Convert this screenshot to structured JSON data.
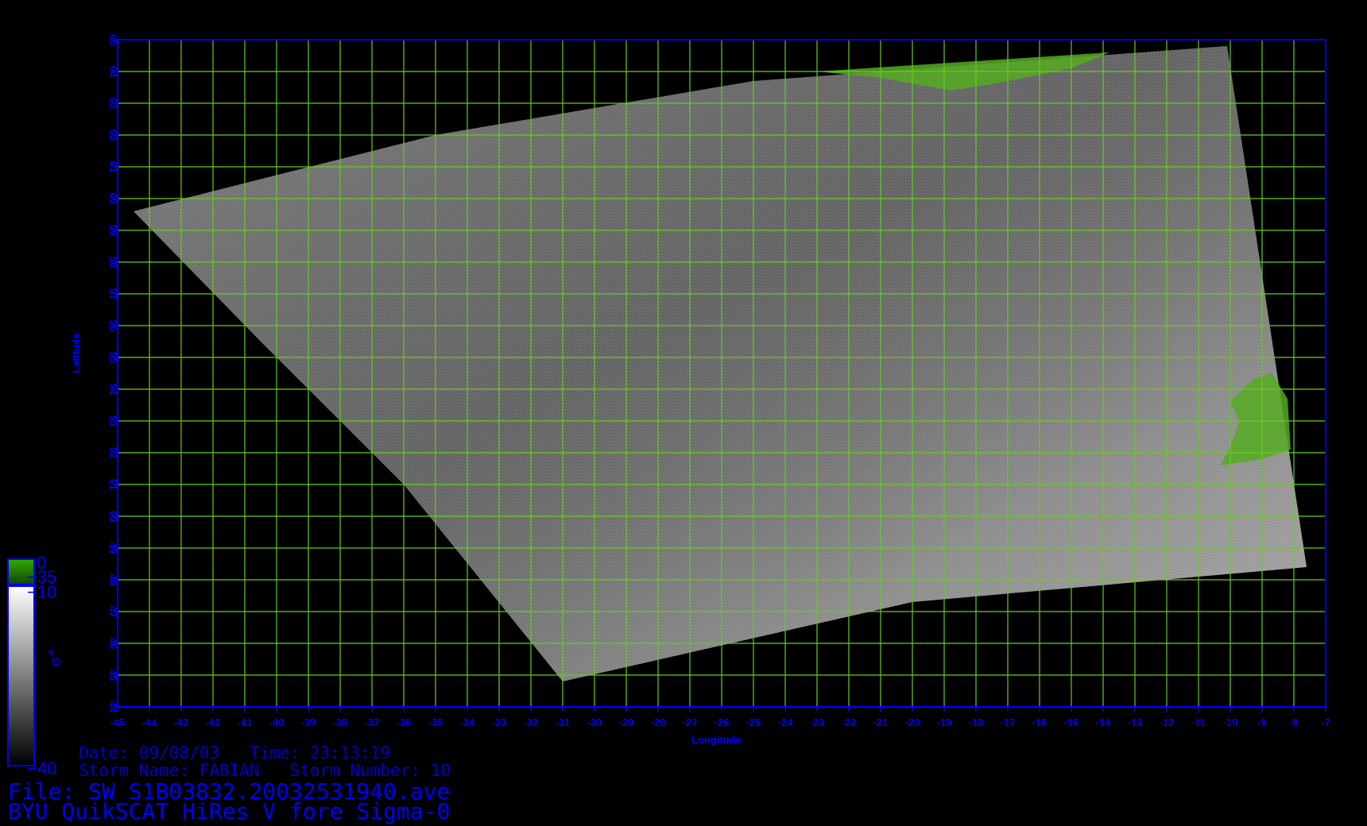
{
  "chart_data": {
    "type": "heatmap",
    "x_axis": {
      "label": "Longitude",
      "range": [
        -45,
        -7
      ],
      "ticks": [
        -45,
        -44,
        -43,
        -42,
        -41,
        -40,
        -39,
        -38,
        -37,
        -36,
        -35,
        -34,
        -33,
        -32,
        -31,
        -30,
        -29,
        -28,
        -27,
        -26,
        -25,
        -24,
        -23,
        -22,
        -21,
        -20,
        -19,
        -18,
        -17,
        -16,
        -15,
        -14,
        -13,
        -12,
        -11,
        -10,
        -9,
        -8,
        -7
      ]
    },
    "y_axis": {
      "label": "Latitude",
      "range": [
        44,
        65
      ],
      "ticks": [
        44,
        45,
        46,
        47,
        48,
        49,
        50,
        51,
        52,
        53,
        54,
        55,
        56,
        57,
        58,
        59,
        60,
        61,
        62,
        63,
        64,
        65
      ]
    },
    "grid": true,
    "grid_color": "#66cc22",
    "swath_outline": [
      {
        "lon": -44.5,
        "lat": 59.6
      },
      {
        "lon": -35.0,
        "lat": 62.0
      },
      {
        "lon": -25.0,
        "lat": 63.7
      },
      {
        "lon": -10.1,
        "lat": 64.8
      },
      {
        "lon": -7.6,
        "lat": 48.4
      },
      {
        "lon": -20.0,
        "lat": 47.3
      },
      {
        "lon": -31.0,
        "lat": 44.8
      },
      {
        "lon": -36.0,
        "lat": 51.0
      },
      {
        "lon": -40.5,
        "lat": 55.5
      }
    ],
    "land_regions": [
      {
        "name": "iceland",
        "color": "#55aa22",
        "points": [
          [
            -23.0,
            64.0
          ],
          [
            -13.8,
            64.6
          ],
          [
            -15.0,
            64.1
          ],
          [
            -17.5,
            63.6
          ],
          [
            -18.8,
            63.4
          ],
          [
            -21.0,
            63.8
          ]
        ]
      },
      {
        "name": "ireland",
        "color": "#55aa22",
        "points": [
          [
            -9.3,
            54.3
          ],
          [
            -8.7,
            54.5
          ],
          [
            -8.2,
            53.7
          ],
          [
            -8.1,
            52.1
          ],
          [
            -9.0,
            51.8
          ],
          [
            -10.3,
            51.6
          ],
          [
            -10.0,
            52.2
          ],
          [
            -9.7,
            53.0
          ],
          [
            -10.0,
            53.6
          ]
        ]
      }
    ],
    "colorbar": {
      "land_range": [
        0,
        -35
      ],
      "sigma0_range": [
        -10,
        -40
      ],
      "ticks": [
        "0",
        "−35",
        "−10",
        "−40"
      ],
      "symbol": "σ°"
    }
  },
  "meta": {
    "date_line": "Date: 09/08/03   Time: 23:13:19",
    "storm_line": "Storm Name: FABIAN   Storm Number: 10",
    "file_line": "File: SW_S1B03832.20032531940.ave",
    "product_line": "BYU QuikSCAT HiRes V fore Sigma-0"
  },
  "colors": {
    "axis": "#0000ff",
    "grid": "#66cc22",
    "land": "#55aa22",
    "background": "#000000"
  }
}
